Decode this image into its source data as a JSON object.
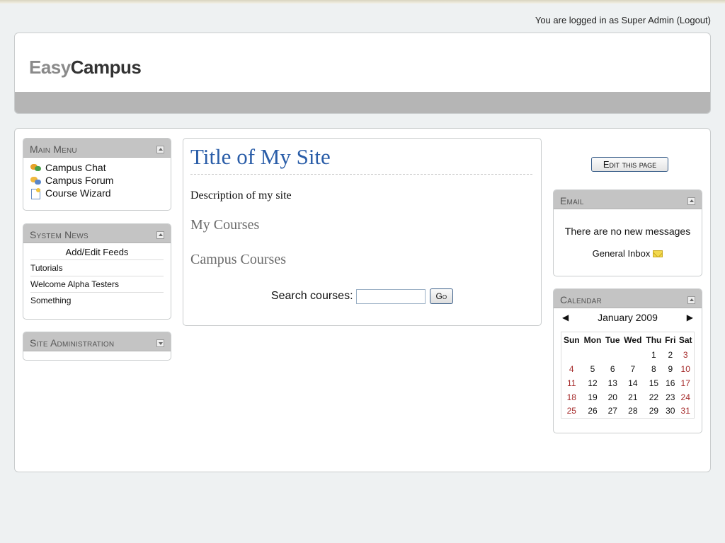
{
  "login": {
    "prefix": "You are logged in as ",
    "user": "Super Admin",
    "logout": "(Logout)"
  },
  "brand": {
    "part1": "Easy",
    "part2": "Campus"
  },
  "main_menu": {
    "title": "Main Menu",
    "items": [
      {
        "label": "Campus Chat",
        "icon": "chat-icon"
      },
      {
        "label": "Campus Forum",
        "icon": "forum-icon"
      },
      {
        "label": "Course Wizard",
        "icon": "wizard-icon"
      }
    ]
  },
  "system_news": {
    "title": "System News",
    "feeds_link": "Add/Edit Feeds",
    "items": [
      "Tutorials",
      "Welcome Alpha Testers",
      "Something"
    ]
  },
  "site_admin": {
    "title": "Site Administration"
  },
  "center": {
    "site_title": "Title of My Site",
    "description": "Description of my site",
    "my_courses": "My Courses",
    "campus_courses": "Campus Courses",
    "search_label": "Search courses:",
    "search_value": "",
    "go_label": "Go"
  },
  "edit_page_label": "Edit this page",
  "email": {
    "title": "Email",
    "message": "There are no new messages",
    "inbox_label": "General Inbox",
    "inbox_icon": "envelope-icon"
  },
  "calendar": {
    "title": "Calendar",
    "month": "January 2009",
    "prev": "◀",
    "next": "▶",
    "weekdays": [
      "Sun",
      "Mon",
      "Tue",
      "Wed",
      "Thu",
      "Fri",
      "Sat"
    ],
    "weeks": [
      [
        "",
        "",
        "",
        "",
        "1",
        "2",
        "3"
      ],
      [
        "4",
        "5",
        "6",
        "7",
        "8",
        "9",
        "10"
      ],
      [
        "11",
        "12",
        "13",
        "14",
        "15",
        "16",
        "17"
      ],
      [
        "18",
        "19",
        "20",
        "21",
        "22",
        "23",
        "24"
      ],
      [
        "25",
        "26",
        "27",
        "28",
        "29",
        "30",
        "31"
      ]
    ],
    "weekend_color": "#a52a2a"
  }
}
